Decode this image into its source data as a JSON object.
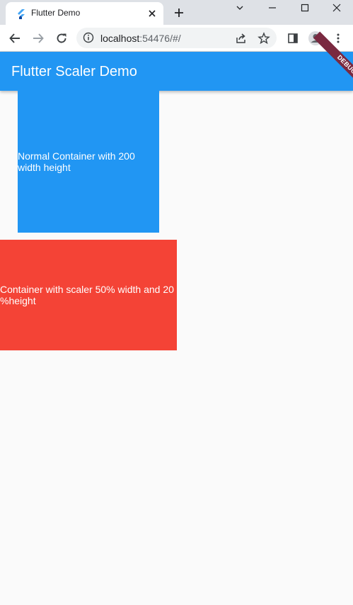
{
  "browser": {
    "tab_title": "Flutter Demo",
    "url_host": "localhost",
    "url_rest": ":54476/#/"
  },
  "app": {
    "title": "Flutter Scaler Demo",
    "debug_label": "DEBUG",
    "normal_container_text": "Normal Container with 200 width height",
    "scaler_container_text": "Container with scaler 50% width and 20 %height"
  },
  "colors": {
    "appbar": "#2196f3",
    "normal_container": "#2196f3",
    "scaler_container": "#f44336",
    "debug_banner": "#7a2940"
  },
  "icons": [
    "flutter-logo-icon",
    "close-icon",
    "plus-icon",
    "chevron-down-icon",
    "minimize-icon",
    "maximize-icon",
    "window-close-icon",
    "back-arrow-icon",
    "forward-arrow-icon",
    "reload-icon",
    "info-icon",
    "share-icon",
    "star-icon",
    "side-panel-icon",
    "profile-icon",
    "kebab-menu-icon"
  ]
}
